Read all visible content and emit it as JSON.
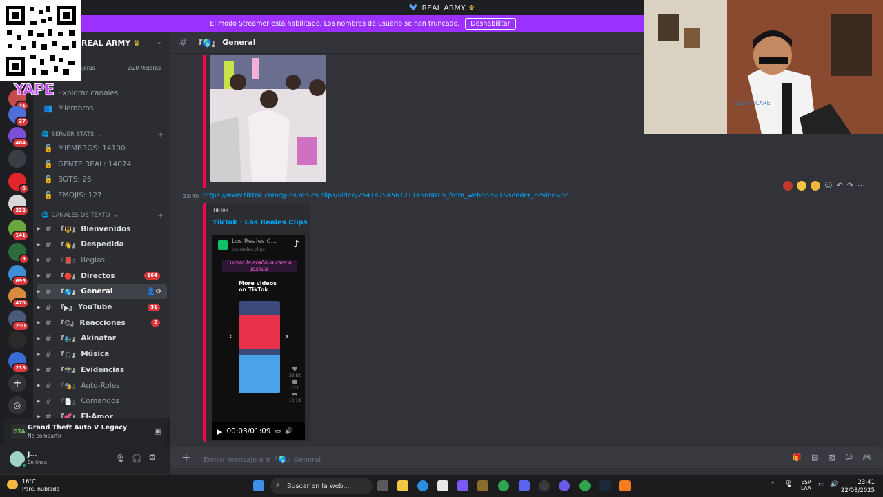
{
  "window": {
    "title": "REAL ARMY"
  },
  "banner": {
    "text": "El modo Streamer está habilitado. Los nombres de usuario se han truncado.",
    "button": "Deshabilitar"
  },
  "server": {
    "name": "REAL ARMY",
    "boost_label": "Mejoras",
    "boost_count": "2/20 Mejoras"
  },
  "nav": {
    "explore": "Explorar canales",
    "members": "Miembros"
  },
  "rail_badges": [
    "31",
    "27",
    "464",
    "6",
    "332",
    "141",
    "3",
    "695",
    "470",
    "230",
    "218"
  ],
  "stats": {
    "category": "SERVER STATS",
    "items": [
      "MIEMBROS: 14100",
      "GENTE REAL: 14074",
      "BOTS: 26",
      "EMOJIS: 127"
    ]
  },
  "text_channels": {
    "category": "CANALES DE TEXTO",
    "items": [
      {
        "name": "Bienvenidos",
        "prefix": "『🔱』",
        "bold": true
      },
      {
        "name": "Despedida",
        "prefix": "『👋』",
        "bold": true
      },
      {
        "name": "Reglas",
        "prefix": "『📕』",
        "bold": false
      },
      {
        "name": "Directos",
        "prefix": "『🔴』",
        "bold": true,
        "badge": "164"
      },
      {
        "name": "General",
        "prefix": "『🌎』",
        "bold": true,
        "active": true
      },
      {
        "name": "YouTube",
        "prefix": "『▶』",
        "bold": true,
        "badge": "51"
      },
      {
        "name": "Reacciones",
        "prefix": "『😍』",
        "bold": true,
        "badge": "2"
      },
      {
        "name": "Akinator",
        "prefix": "『🧞』",
        "bold": true
      },
      {
        "name": "Música",
        "prefix": "『🎵』",
        "bold": true
      },
      {
        "name": "Evidencias",
        "prefix": "『📸』",
        "bold": true
      },
      {
        "name": "Auto-Roles",
        "prefix": "『🎭』",
        "bold": false
      },
      {
        "name": "Comandos",
        "prefix": "『📄』",
        "bold": false
      },
      {
        "name": "El-Amor",
        "prefix": "『💕』",
        "bold": true
      }
    ]
  },
  "activity": {
    "game": "Grand Theft Auto V Legacy",
    "status": "No compartir",
    "icon_text": "GTA"
  },
  "user": {
    "name": "J...",
    "status": "En línea"
  },
  "chat": {
    "channel": "General",
    "channel_prefix": "『🌎』",
    "message": {
      "time": "23:40",
      "link": "https://www.tiktok.com/@los.reales.clips/video/7541479456121146680?is_from_webapp=1&sender_device=pc",
      "embed_provider": "TikTok",
      "embed_title": "TikTok · Los Reales Clips",
      "video_channel": "Los Reales C...",
      "video_handle": "los.reales.clips",
      "video_caption": "Lucero le arañó la cara a Joshua",
      "video_more": "More videos on TikTok",
      "video_likes": "38.8K",
      "video_comments": "227",
      "video_shares": "10.1K",
      "video_time": "00:03/01:09"
    },
    "composer_placeholder": "Enviar mensaje a #『🌎』General"
  },
  "qr_overlay": {
    "text": "YAPE"
  },
  "webcam": {
    "shirt_text": "I DON'T CARE"
  },
  "taskbar": {
    "search": "Buscar en la web...",
    "weather_temp": "16°C",
    "weather_desc": "Parc. nublado",
    "lang": "ESP",
    "lang2": "LAA",
    "time": "23:41",
    "date": "22/08/2025"
  },
  "colors": {
    "streamer_purple": "#9b30ff",
    "mention_red": "#da373c",
    "link_blue": "#00a8fc",
    "tiktok_pink": "#ff0050"
  }
}
